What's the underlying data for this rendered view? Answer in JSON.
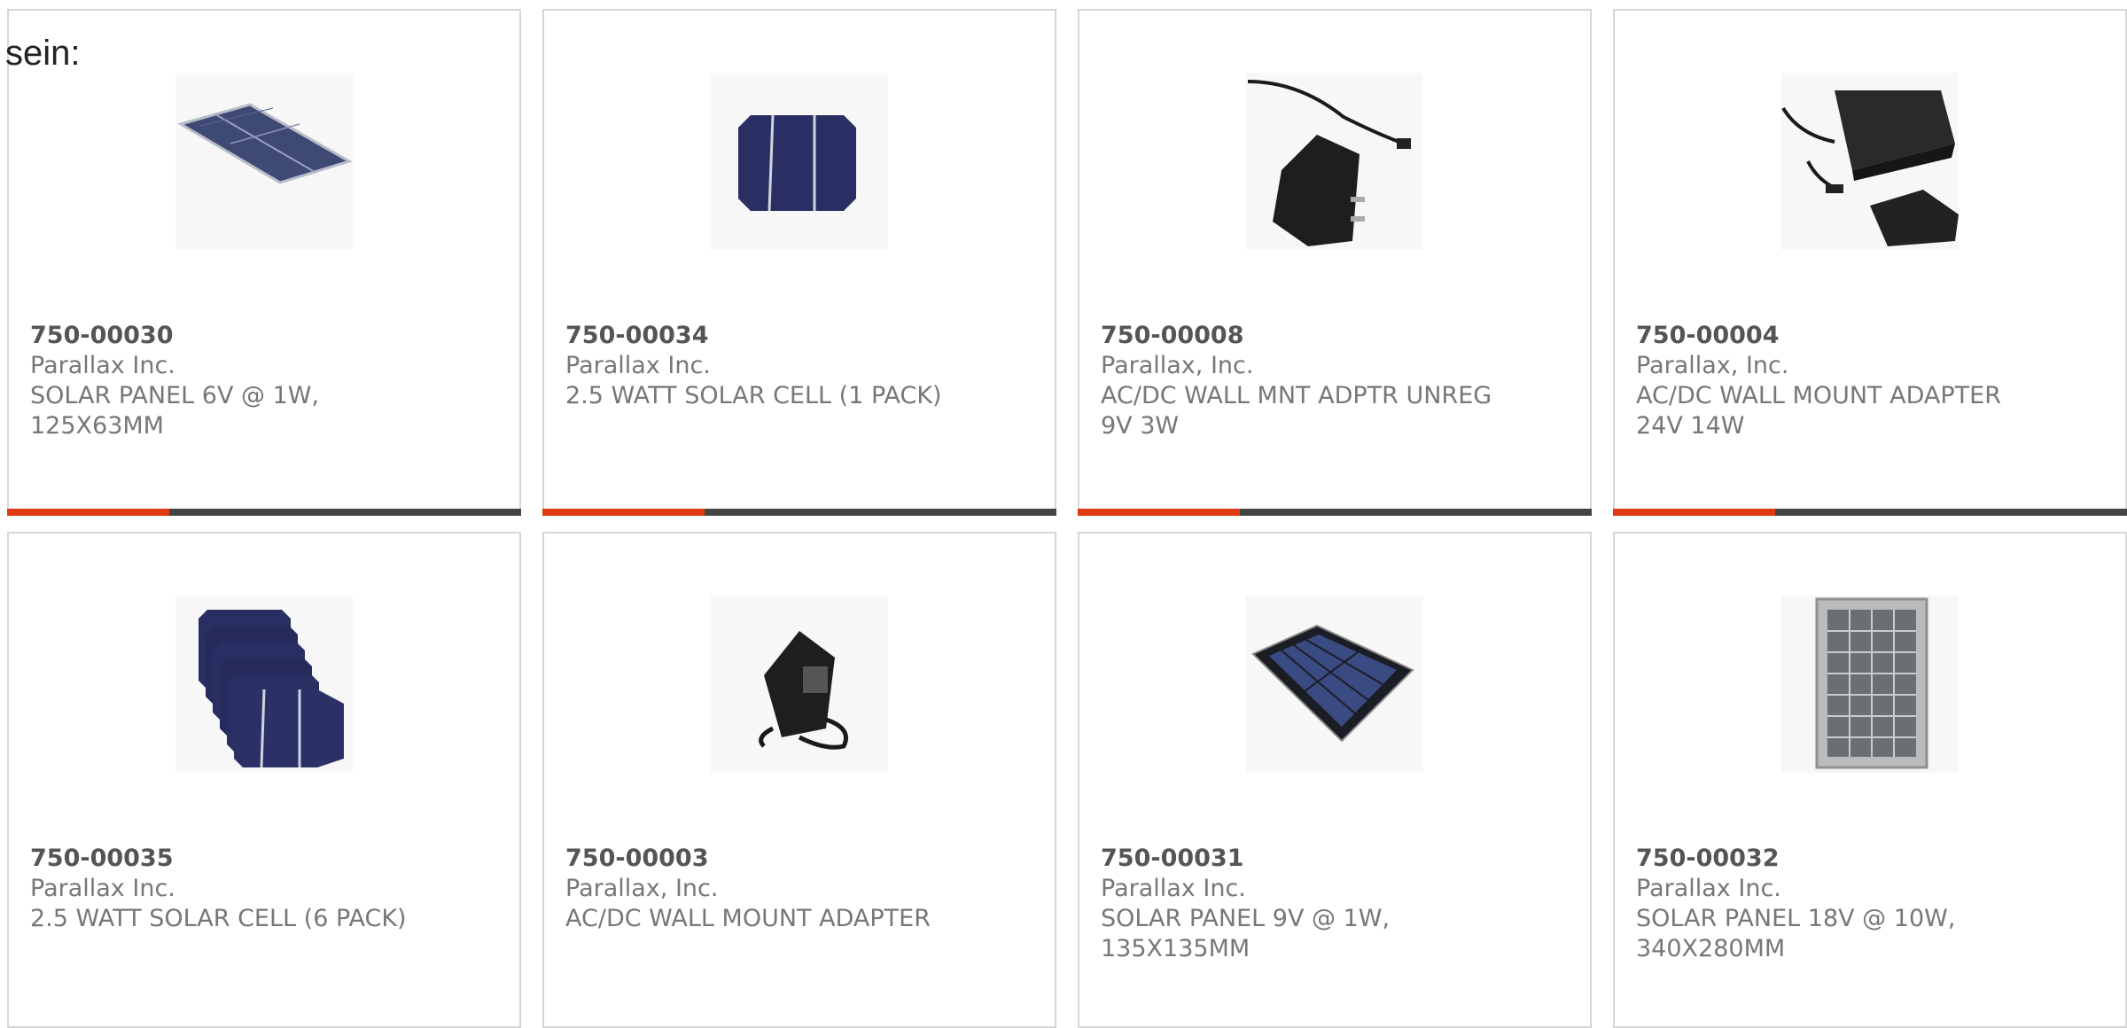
{
  "intro_text": "sein:",
  "colors": {
    "accent": "#e03a12",
    "bar": "#444444",
    "border": "#d6d6d6"
  },
  "products": [
    {
      "part_number": "750-00030",
      "manufacturer": "Parallax Inc.",
      "description": "SOLAR PANEL 6V @ 1W,\n125X63MM",
      "image": "solar-panel-small-icon"
    },
    {
      "part_number": "750-00034",
      "manufacturer": "Parallax Inc.",
      "description": "2.5 WATT SOLAR CELL (1 PACK)",
      "image": "solar-cell-icon"
    },
    {
      "part_number": "750-00008",
      "manufacturer": "Parallax, Inc.",
      "description": "AC/DC WALL MNT ADPTR UNREG\n9V 3W",
      "image": "wall-adapter-icon"
    },
    {
      "part_number": "750-00004",
      "manufacturer": "Parallax, Inc.",
      "description": "AC/DC WALL MOUNT ADAPTER\n24V 14W",
      "image": "wall-adapter-plug-icon"
    },
    {
      "part_number": "750-00035",
      "manufacturer": "Parallax Inc.",
      "description": "2.5 WATT SOLAR CELL (6 PACK)",
      "image": "solar-cell-stack-icon"
    },
    {
      "part_number": "750-00003",
      "manufacturer": "Parallax, Inc.",
      "description": "AC/DC WALL MOUNT ADAPTER",
      "image": "wall-adapter-small-icon"
    },
    {
      "part_number": "750-00031",
      "manufacturer": "Parallax Inc.",
      "description": "SOLAR PANEL 9V @ 1W,\n135X135MM",
      "image": "solar-panel-square-icon"
    },
    {
      "part_number": "750-00032",
      "manufacturer": "Parallax Inc.",
      "description": "SOLAR PANEL 18V @ 10W,\n340X280MM",
      "image": "solar-panel-framed-icon"
    }
  ]
}
